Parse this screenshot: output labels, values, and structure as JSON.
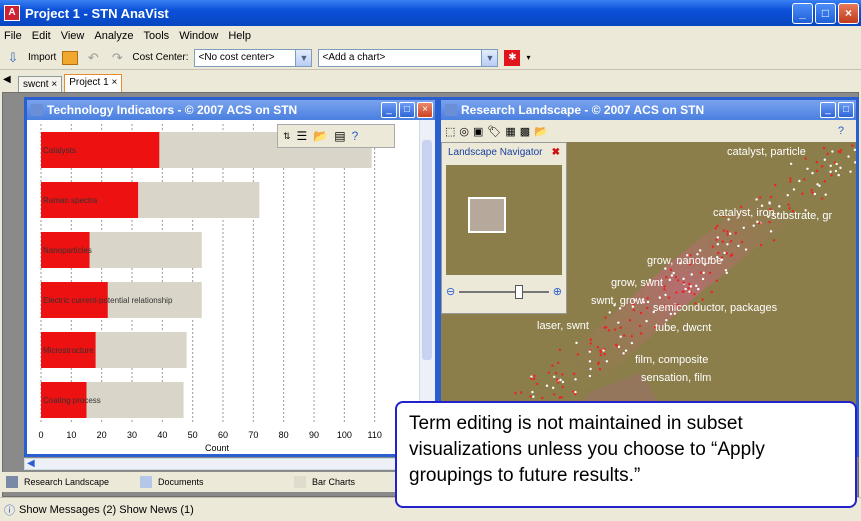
{
  "window": {
    "title": "Project 1 - STN AnaVist"
  },
  "menu": [
    "File",
    "Edit",
    "View",
    "Analyze",
    "Tools",
    "Window",
    "Help"
  ],
  "toolbar": {
    "import_label": "Import",
    "cost_center_label": "Cost Center:",
    "cost_center_value": "<No cost center>",
    "add_chart_value": "<Add a chart>"
  },
  "tabs": [
    {
      "label": "swcnt",
      "close": "×"
    },
    {
      "label": "Project 1",
      "close": "×"
    }
  ],
  "tech_window": {
    "title": "Technology Indicators - © 2007 ACS on STN"
  },
  "chart_data": {
    "type": "bar",
    "orientation": "horizontal",
    "categories": [
      "Catalysts",
      "Raman spectra",
      "Nanoparticles",
      "Electric current-potential relationship",
      "Microstructure",
      "Coating process"
    ],
    "series": [
      {
        "values": [
          39,
          32,
          16,
          22,
          18,
          15
        ],
        "color": "#ee1111"
      },
      {
        "values": [
          109,
          72,
          53,
          53,
          48,
          47
        ],
        "color": "#d9d5c8"
      }
    ],
    "xlabel": "Count",
    "xticks": [
      0,
      10,
      20,
      30,
      40,
      50,
      60,
      70,
      80,
      90,
      100,
      110
    ],
    "xlim": [
      0,
      120
    ],
    "grid": "vertical dashed"
  },
  "research_window": {
    "title": "Research Landscape - © 2007 ACS on STN",
    "navigator_label": "Landscape Navigator",
    "terms": [
      "catalyst, particle",
      "catalyst, iron",
      "substrate, gr",
      "grow, nanotube",
      "grow, swnt",
      "swnt, grow",
      "semiconductor, packages",
      "tube, dwcnt",
      "laser, swnt",
      "film, composite",
      "sensation, film"
    ]
  },
  "bottom_tabs": [
    "Research Landscape",
    "Documents",
    "Bar Charts"
  ],
  "status": {
    "text": "Show Messages (2)  Show News (1)"
  },
  "callout": {
    "text": "Term editing is not maintained in subset visualizations unless you choose to “Apply groupings to future results.”"
  }
}
